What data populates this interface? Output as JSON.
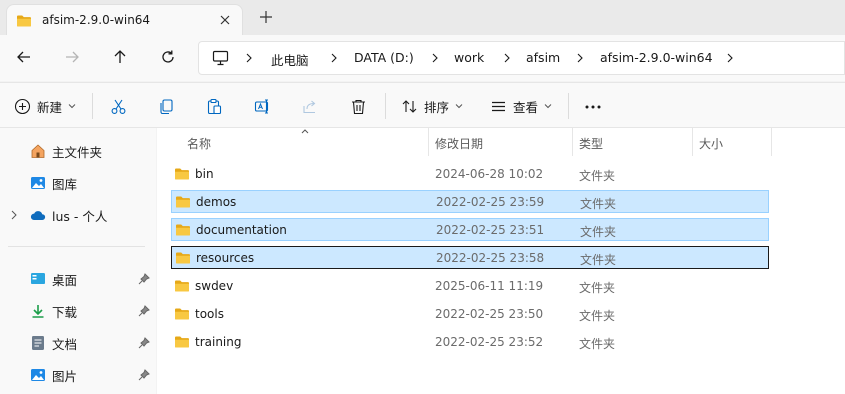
{
  "window": {
    "tab_title": "afsim-2.9.0-win64"
  },
  "breadcrumb": [
    "此电脑",
    "DATA (D:)",
    "work",
    "afsim",
    "afsim-2.9.0-win64"
  ],
  "toolbar": {
    "new_label": "新建",
    "sort_label": "排序",
    "view_label": "查看"
  },
  "sidebar": {
    "quick": [
      {
        "label": "主文件夹",
        "icon": "home-icon"
      },
      {
        "label": "图库",
        "icon": "gallery-icon"
      },
      {
        "label": "lus - 个人",
        "icon": "cloud-icon"
      }
    ],
    "pinned": [
      {
        "label": "桌面",
        "icon": "desktop-icon"
      },
      {
        "label": "下载",
        "icon": "download-icon"
      },
      {
        "label": "文档",
        "icon": "document-icon"
      },
      {
        "label": "图片",
        "icon": "pictures-icon"
      }
    ]
  },
  "columns": {
    "name": "名称",
    "date": "修改日期",
    "type": "类型",
    "size": "大小"
  },
  "files": [
    {
      "name": "bin",
      "date": "2024-06-28 10:02",
      "type": "文件夹",
      "state": "normal"
    },
    {
      "name": "demos",
      "date": "2022-02-25 23:59",
      "type": "文件夹",
      "state": "selected"
    },
    {
      "name": "documentation",
      "date": "2022-02-25 23:51",
      "type": "文件夹",
      "state": "selected"
    },
    {
      "name": "resources",
      "date": "2022-02-25 23:58",
      "type": "文件夹",
      "state": "focused"
    },
    {
      "name": "swdev",
      "date": "2025-06-11 11:19",
      "type": "文件夹",
      "state": "normal"
    },
    {
      "name": "tools",
      "date": "2022-02-25 23:50",
      "type": "文件夹",
      "state": "normal"
    },
    {
      "name": "training",
      "date": "2022-02-25 23:52",
      "type": "文件夹",
      "state": "normal"
    }
  ],
  "colors": {
    "selection": "#cce8ff",
    "selection_border": "#99d1ff",
    "folder": "#f8c842",
    "accent": "#0067c0"
  }
}
